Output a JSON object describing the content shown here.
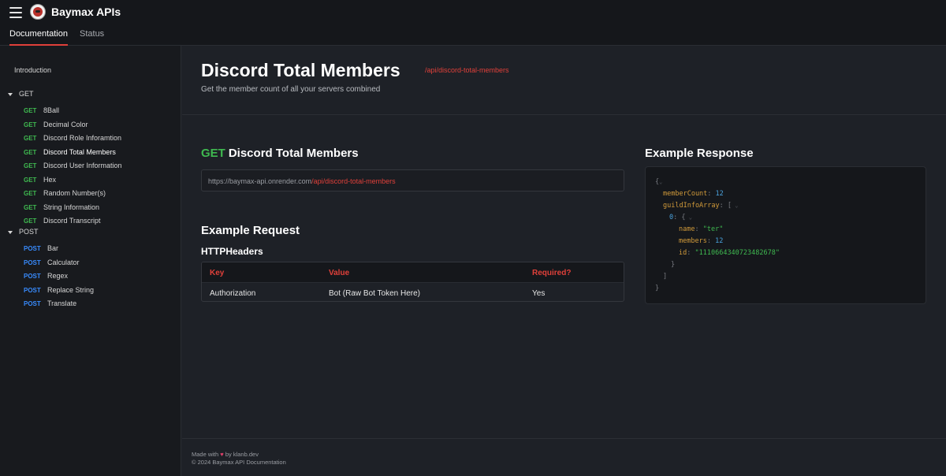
{
  "app": {
    "title": "Baymax APIs"
  },
  "top_tabs": [
    {
      "label": "Documentation",
      "active": true
    },
    {
      "label": "Status",
      "active": false
    }
  ],
  "sidebar": {
    "intro": "Introduction",
    "groups": [
      {
        "label": "GET",
        "items": [
          {
            "method": "GET",
            "label": "8Ball"
          },
          {
            "method": "GET",
            "label": "Decimal Color"
          },
          {
            "method": "GET",
            "label": "Discord Role Inforamtion"
          },
          {
            "method": "GET",
            "label": "Discord Total Members"
          },
          {
            "method": "GET",
            "label": "Discord User Information"
          },
          {
            "method": "GET",
            "label": "Hex"
          },
          {
            "method": "GET",
            "label": "Random Number(s)"
          },
          {
            "method": "GET",
            "label": "String Information"
          },
          {
            "method": "GET",
            "label": "Discord Transcript"
          }
        ]
      },
      {
        "label": "POST",
        "items": [
          {
            "method": "POST",
            "label": "Bar"
          },
          {
            "method": "POST",
            "label": "Calculator"
          },
          {
            "method": "POST",
            "label": "Regex"
          },
          {
            "method": "POST",
            "label": "Replace String"
          },
          {
            "method": "POST",
            "label": "Translate"
          }
        ]
      }
    ]
  },
  "page": {
    "title": "Discord Total Members",
    "path": "/api/discord-total-members",
    "description": "Get the member count of all your servers combined"
  },
  "endpoint": {
    "method": "GET",
    "name": "Discord Total Members",
    "url_base": "https://baymax-api.onrender.com",
    "url_path": "/api/discord-total-members"
  },
  "request": {
    "title": "Example Request",
    "headers_title": "HTTPHeaders",
    "columns": [
      "Key",
      "Value",
      "Required?"
    ],
    "rows": [
      [
        "Authorization",
        "Bot (Raw Bot Token Here)",
        "Yes"
      ]
    ]
  },
  "response": {
    "title": "Example Response",
    "memberCount_key": "memberCount",
    "memberCount": "12",
    "guildInfoArray_key": "guildInfoArray",
    "index": "0",
    "name_key": "name",
    "name": "\"ter\"",
    "members_key": "members",
    "members": "12",
    "id_key": "id",
    "id": "\"1110664340723482678\""
  },
  "footer": {
    "made_with": "Made with",
    "by": "by klanb.dev",
    "copyright": "© 2024 Baymax API Documentation"
  },
  "colors": {
    "accent": "#e0403a",
    "get": "#3fb950",
    "post": "#388bfd",
    "background": "#1e2127"
  }
}
